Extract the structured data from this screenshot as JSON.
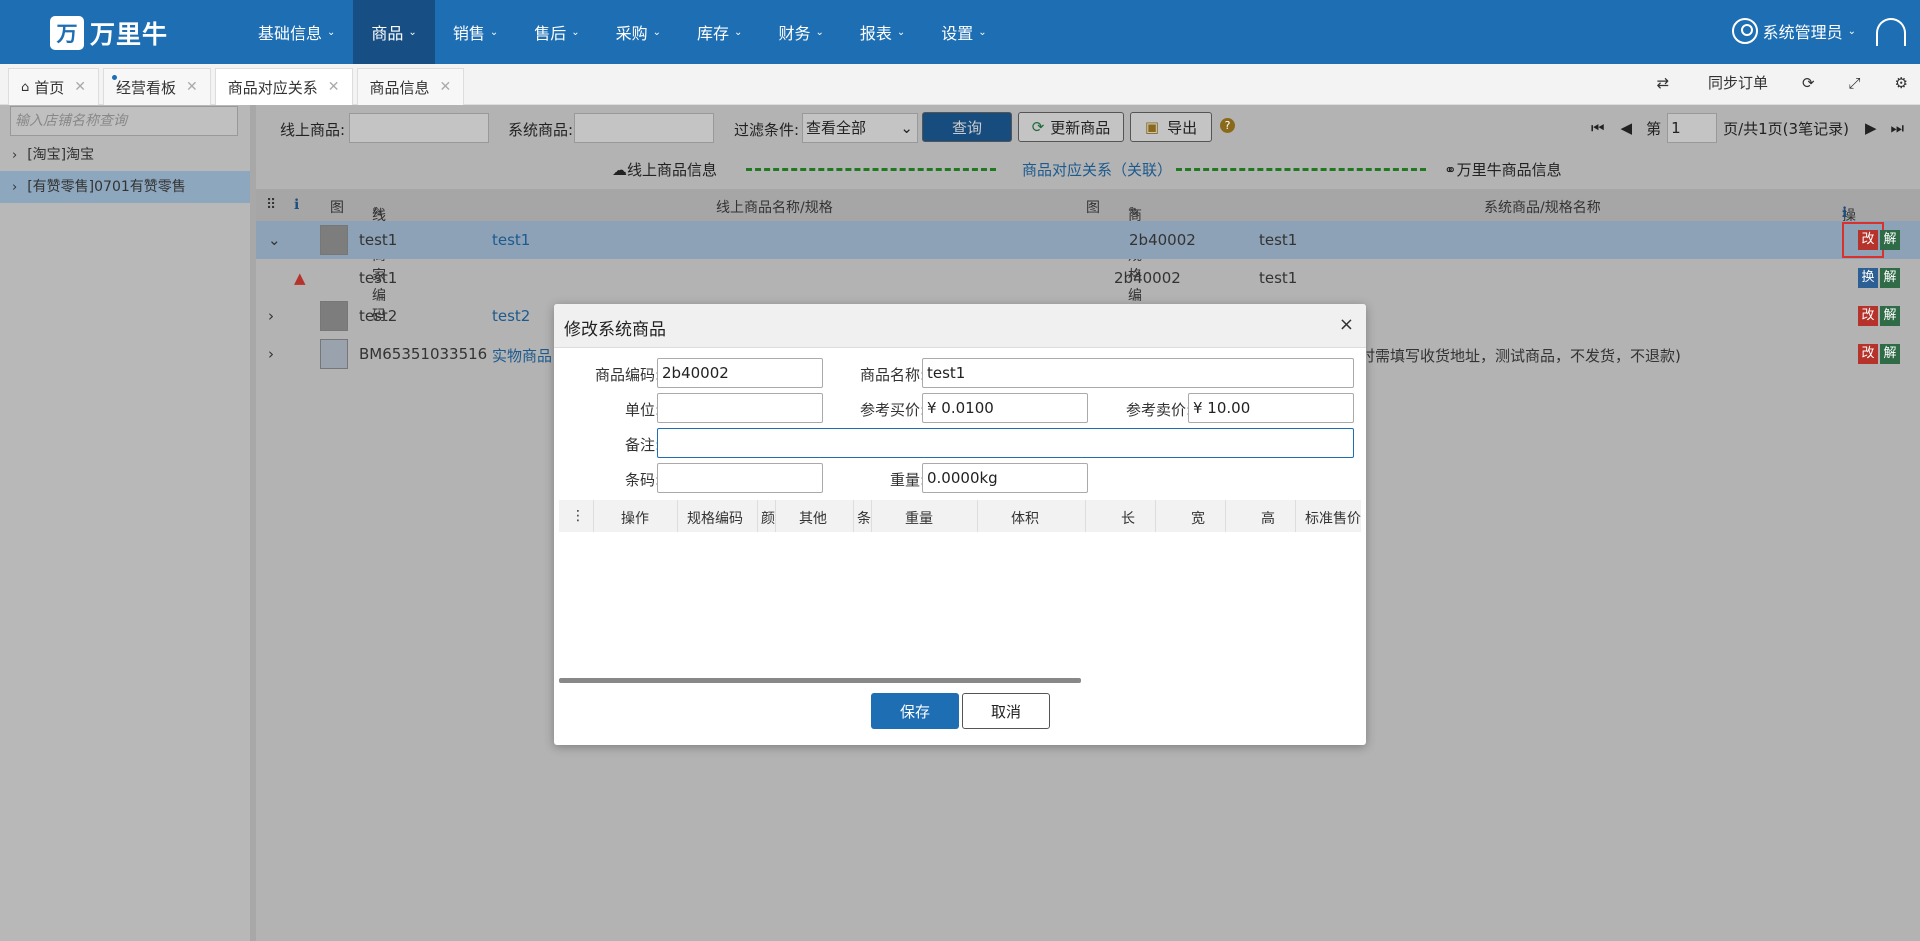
{
  "brand": {
    "mark": "万",
    "name": "万里牛"
  },
  "nav": [
    {
      "label": "基础信息"
    },
    {
      "label": "商品"
    },
    {
      "label": "销售"
    },
    {
      "label": "售后"
    },
    {
      "label": "采购"
    },
    {
      "label": "库存"
    },
    {
      "label": "财务"
    },
    {
      "label": "报表"
    },
    {
      "label": "设置"
    }
  ],
  "user": {
    "name": "系统管理员"
  },
  "tabs": [
    {
      "label": "首页"
    },
    {
      "label": "经营看板"
    },
    {
      "label": "商品对应关系"
    },
    {
      "label": "商品信息"
    }
  ],
  "toolbar_right": {
    "sync": "同步订单"
  },
  "sidebar": {
    "search_placeholder": "输入店铺名称查询",
    "items": [
      {
        "label": "[淘宝]淘宝"
      },
      {
        "label": "[有赞零售]0701有赞零售"
      }
    ]
  },
  "filters": {
    "online_label": "线上商品:",
    "system_label": "系统商品:",
    "cond_label": "过滤条件:",
    "cond_value": "查看全部",
    "query_button": "查询",
    "update_button": "更新商品",
    "export_button": "导出"
  },
  "pager": {
    "prefix": "第",
    "page": "1",
    "suffix": "页/共1页(3笔记录)"
  },
  "legend": {
    "left": "线上商品信息",
    "mid": "商品对应关系（关联）",
    "right": "万里牛商品信息"
  },
  "grid_headers": {
    "img": "图",
    "merchant_code": "线上商家编码",
    "online_name": "线上商品名称/规格",
    "img2": "图",
    "sku_code": "商品/规格编码",
    "sys_name": "系统商品/规格名称",
    "ops": "操作"
  },
  "rows": [
    {
      "code": "test1",
      "name": "test1",
      "sku": "2b40002",
      "sys": "test1",
      "b1": "改",
      "b2": "解"
    },
    {
      "code": "test1",
      "name": "",
      "sku": "2b40002",
      "sys": "test1",
      "b1": "换",
      "b2": "解"
    },
    {
      "code": "test2",
      "name": "test2",
      "sku": "",
      "sys": "",
      "b1": "改",
      "b2": "解"
    },
    {
      "code": "BM65351033516",
      "name": "实物商品",
      "sku": "",
      "sys": "时需填写收货地址，测试商品，不发货，不退款)",
      "b1": "改",
      "b2": "解"
    }
  ],
  "modal": {
    "title": "修改系统商品",
    "close": "×",
    "code_label": "商品编码:",
    "code_value": "2b40002",
    "name_label": "商品名称:",
    "name_value": "test1",
    "unit_label": "单位:",
    "buy_label": "参考买价:",
    "buy_value": "¥ 0.0100",
    "sell_label": "参考卖价:",
    "sell_value": "¥ 10.00",
    "remark_label": "备注:",
    "barcode_label": "条码:",
    "weight_label": "重量:",
    "weight_value": "0.0000kg",
    "grid": [
      "操作",
      "规格编码",
      "颜",
      "其他",
      "条",
      "重量",
      "体积",
      "长",
      "宽",
      "高",
      "标准售价"
    ],
    "save": "保存",
    "cancel": "取消"
  }
}
